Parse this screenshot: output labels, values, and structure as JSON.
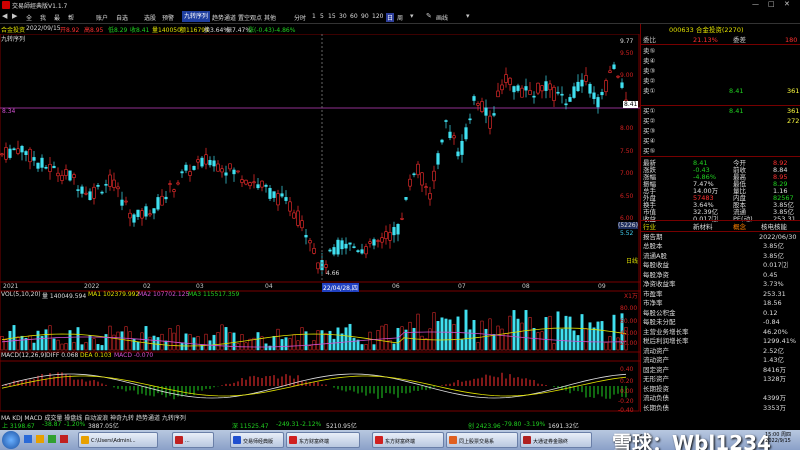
{
  "window": {
    "title": "交易師經典版V1.1.7",
    "controls": [
      "—",
      "□",
      "✕"
    ]
  },
  "toolbar": {
    "items": [
      "全",
      "我",
      "最",
      "帮",
      "账户",
      "自选",
      "选股",
      "预警",
      "九转序列",
      "趋势通道",
      "置空观点",
      "其他"
    ],
    "active": "九转序列",
    "periods": [
      "分时",
      "1",
      "5",
      "15",
      "30",
      "60",
      "90",
      "120",
      "日",
      "周"
    ],
    "selected_period": "日",
    "tail": [
      "画线"
    ]
  },
  "info": {
    "name": "合金投资",
    "date": "2022/09/15",
    "open": "开8.92",
    "high": "高8.95",
    "low": "低8.29",
    "close": "收8.41",
    "vol": "量140050",
    "amount": "额116791",
    "turnover": "换3.64%",
    "amp": "振7.47%",
    "change": "涨(-0.43)-4.86%",
    "indicator": "九转序列"
  },
  "chart": {
    "y_ticks": [
      "9.77",
      "9.50",
      "9.00",
      "8.50",
      "8.00",
      "7.50",
      "7.00",
      "6.50",
      "6.00",
      "5.52",
      "5.00"
    ],
    "current_price": "8.41",
    "high_label": "9.77",
    "low_label": "4.66",
    "left_price": "8.34",
    "month_labels": [
      "2021",
      "2022",
      "02",
      "03",
      "04",
      "22/04/28,四",
      "06",
      "07",
      "08",
      "09"
    ],
    "side_tags": [
      "(5226)",
      "5.52",
      "日线"
    ],
    "vol_header": {
      "title": "VOL(5,10,20)",
      "vol": "量 140049.594",
      "ma1": "MA1 102379.992",
      "ma2": "MA2 107702.125",
      "ma3": "MA3 115517.359"
    },
    "vol_ticks": [
      "80.00",
      "60.00",
      "40.00",
      "20.00"
    ],
    "vol_unit": "X1万",
    "macd_header": {
      "title": "MACD(12,26,9)",
      "diff": "DIFF 0.068",
      "dea": "DEA 0.103",
      "macd": "MACD -0.070"
    },
    "macd_ticks": [
      "0.40",
      "0.20",
      "0.00",
      "-0.20",
      "-0.40"
    ],
    "bottom_tabs": "MA KDJ MACD 成交量 操盘线 自动波浪 神奇九转 趋势通道 九转序列"
  },
  "right_panel": {
    "code_name": "000633 合金投资(2270)",
    "weibi": {
      "label": "委比",
      "value": "21.13%",
      "label2": "委差",
      "value2": "180"
    },
    "sells": [
      {
        "label": "卖⑤",
        "price": "",
        "vol": ""
      },
      {
        "label": "卖④",
        "price": "",
        "vol": ""
      },
      {
        "label": "卖③",
        "price": "",
        "vol": ""
      },
      {
        "label": "卖②",
        "price": "",
        "vol": ""
      },
      {
        "label": "卖①",
        "price": "8.41",
        "vol": "361"
      }
    ],
    "buys": [
      {
        "label": "买①",
        "price": "8.41",
        "vol": "361"
      },
      {
        "label": "买②",
        "price": "",
        "vol": "272"
      },
      {
        "label": "买③",
        "price": "",
        "vol": ""
      },
      {
        "label": "买④",
        "price": "",
        "vol": ""
      },
      {
        "label": "买⑤",
        "price": "",
        "vol": ""
      }
    ],
    "quote": [
      {
        "l1": "最新",
        "v1": "8.41",
        "l2": "今开",
        "v2": "8.92",
        "c1": "grn",
        "c2": "red"
      },
      {
        "l1": "涨跌",
        "v1": "-0.43",
        "l2": "前收",
        "v2": "8.84",
        "c1": "grn",
        "c2": "wht"
      },
      {
        "l1": "涨幅",
        "v1": "-4.86%",
        "l2": "最高",
        "v2": "8.95",
        "c1": "grn",
        "c2": "red"
      },
      {
        "l1": "振幅",
        "v1": "7.47%",
        "l2": "最低",
        "v2": "8.29",
        "c1": "wht",
        "c2": "grn"
      },
      {
        "l1": "总手",
        "v1": "14.00万",
        "l2": "量比",
        "v2": "1.16",
        "c1": "wht",
        "c2": "wht"
      },
      {
        "l1": "外盘",
        "v1": "57483",
        "l2": "内盘",
        "v2": "82567",
        "c1": "red",
        "c2": "grn"
      },
      {
        "l1": "换手",
        "v1": "3.64%",
        "l2": "股本",
        "v2": "3.85亿",
        "c1": "wht",
        "c2": "wht"
      },
      {
        "l1": "市值",
        "v1": "32.39亿",
        "l2": "流通",
        "v2": "3.85亿",
        "c1": "wht",
        "c2": "wht"
      },
      {
        "l1": "收益",
        "v1": "0.017⑵",
        "l2": "PE(动)",
        "v2": "253.31",
        "c1": "wht",
        "c2": "wht"
      }
    ],
    "industry": {
      "label": "行业",
      "v1": "新材料",
      "l2": "概念",
      "v2": "核电核能"
    },
    "fin_header": {
      "label": "报告期",
      "value": "2022/06/30"
    },
    "fin": [
      {
        "label": "总股本",
        "value": "3.85亿"
      },
      {
        "label": "流通A股",
        "value": "3.85亿"
      },
      {
        "label": "每股收益",
        "value": "0.017⑵"
      },
      {
        "label": "每股净资",
        "value": "0.45"
      },
      {
        "label": "净资收益率",
        "value": "3.73%"
      },
      {
        "label": "市盈率",
        "value": "253.31"
      },
      {
        "label": "市净率",
        "value": "18.56"
      },
      {
        "label": "每股公积金",
        "value": "0.12"
      },
      {
        "label": "每股未分配",
        "value": "-0.84"
      },
      {
        "label": "主营业务增长率",
        "value": "46.20%"
      },
      {
        "label": "税后利润增长率",
        "value": "1299.41%"
      },
      {
        "label": "流动资产",
        "value": "2.52亿"
      },
      {
        "label": "流动资产",
        "value": "1.43亿"
      },
      {
        "label": "固定资产",
        "value": "8416万"
      },
      {
        "label": "无形资产",
        "value": "1328万"
      },
      {
        "label": "长期投资",
        "value": ""
      },
      {
        "label": "流动负债",
        "value": "4399万"
      },
      {
        "label": "长期负债",
        "value": "3353万"
      }
    ]
  },
  "status_line": {
    "items": [
      "上 3198.67",
      "-38.87",
      "-1.20%",
      "3887.05亿",
      "深 11525.47",
      "-249.31",
      "-2.12%",
      "5210.95亿",
      "创 2423.96",
      "-79.80",
      "-3.19%",
      "1691.32亿"
    ]
  },
  "taskbar": {
    "tasks": [
      "C:\\Users\\Admini...",
      "东方财富终端",
      "交易师经典版",
      "东方财富终端",
      "同上股票交易系",
      "大通证券金融终"
    ],
    "clock_time": "15:00 周四",
    "clock_date": "2022/9/15",
    "cpu": "68%"
  },
  "watermark": "雪球：Wbl1234"
}
